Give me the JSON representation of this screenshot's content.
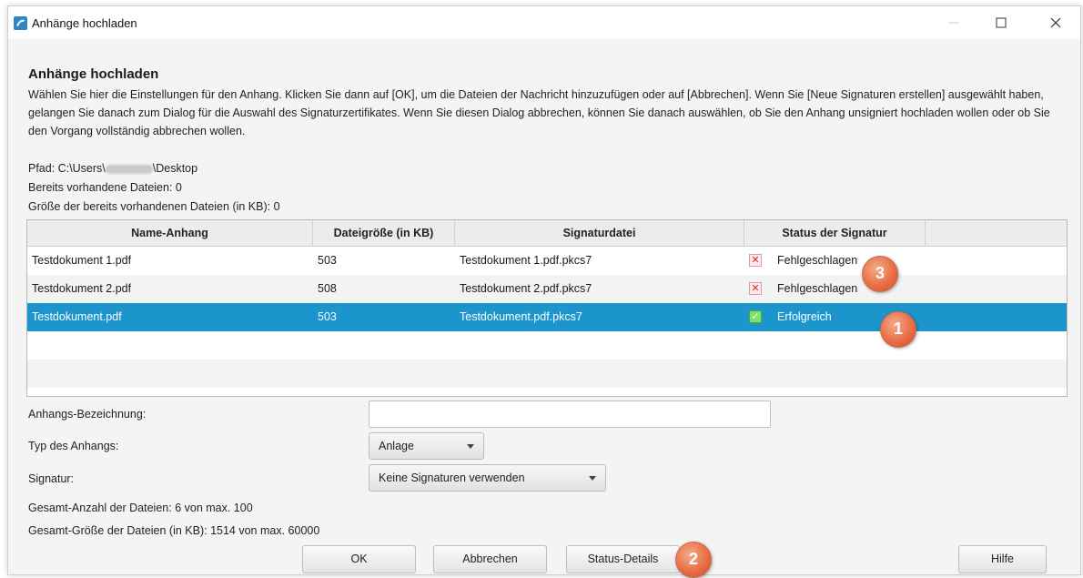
{
  "window": {
    "title": "Anhänge hochladen",
    "controls": {
      "minimize": "—",
      "maximize": "☐",
      "close": "✕"
    }
  },
  "dialog": {
    "heading": "Anhänge hochladen",
    "description": "Wählen Sie hier die Einstellungen für den Anhang. Klicken Sie dann auf [OK], um die Dateien der Nachricht hinzuzufügen oder auf [Abbrechen]. Wenn Sie [Neue Signaturen erstellen] ausgewählt haben, gelangen Sie danach zum Dialog für die Auswahl des Signaturzertifikates. Wenn Sie diesen Dialog abbrechen, können Sie danach auswählen, ob Sie den Anhang unsigniert hochladen wollen oder ob Sie den Vorgang vollständig abbrechen wollen.",
    "path_prefix": "Pfad: C:\\Users\\",
    "path_suffix": "\\Desktop",
    "existing_files": "Bereits vorhandene Dateien: 0",
    "existing_size": "Größe der bereits vorhandenen Dateien (in KB): 0"
  },
  "table": {
    "columns": [
      "Name-Anhang",
      "Dateigröße (in KB)",
      "Signaturdatei",
      "Status der Signatur"
    ],
    "rows": [
      {
        "name": "Testdokument 1.pdf",
        "size": "503",
        "sigfile": "Testdokument 1.pdf.pkcs7",
        "status": "Fehlgeschlagen",
        "status_icon": "✕"
      },
      {
        "name": "Testdokument 2.pdf",
        "size": "508",
        "sigfile": "Testdokument 2.pdf.pkcs7",
        "status": "Fehlgeschlagen",
        "status_icon": "✕"
      },
      {
        "name": "Testdokument.pdf",
        "size": "503",
        "sigfile": "Testdokument.pdf.pkcs7",
        "status": "Erfolgreich",
        "status_icon": "✓"
      }
    ]
  },
  "form": {
    "label_bezeichnung": "Anhangs-Bezeichnung:",
    "bezeichnung_value": "",
    "label_typ": "Typ des Anhangs:",
    "typ_value": "Anlage",
    "label_signatur": "Signatur:",
    "signatur_value": "Keine Signaturen verwenden"
  },
  "totals": {
    "count": "Gesamt-Anzahl der Dateien: 6 von max. 100",
    "size": "Gesamt-Größe der Dateien (in KB): 1514 von max. 60000"
  },
  "buttons": {
    "ok": "OK",
    "cancel": "Abbrechen",
    "status": "Status-Details",
    "help": "Hilfe"
  },
  "callouts": {
    "one": "1",
    "two": "2",
    "three": "3"
  },
  "colors": {
    "selection": "#1b95cc",
    "callout": "#e86f45",
    "success": "#7fe06b",
    "failure": "#d12b2b"
  }
}
